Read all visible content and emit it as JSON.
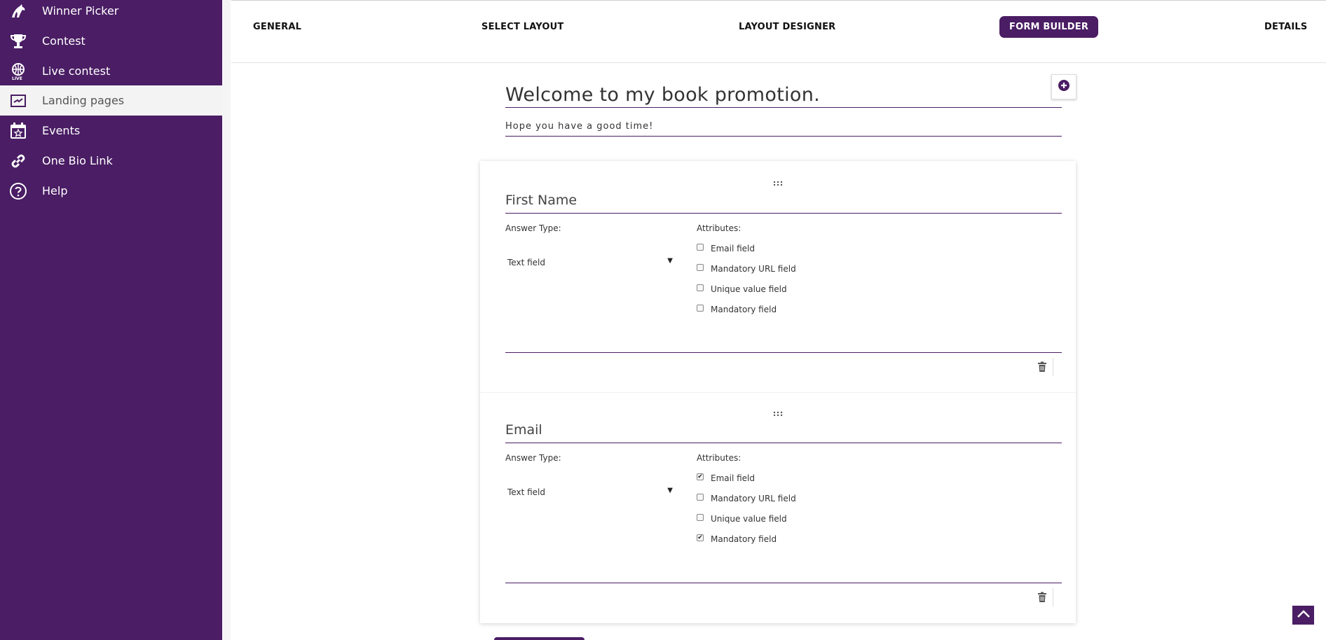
{
  "sidebar": {
    "items": [
      {
        "label": "Winner Picker",
        "icon": "winner-picker-icon"
      },
      {
        "label": "Contest",
        "icon": "trophy-icon"
      },
      {
        "label": "Live contest",
        "icon": "live-globe-icon"
      },
      {
        "label": "Landing pages",
        "icon": "landing-page-icon",
        "active": true
      },
      {
        "label": "Events",
        "icon": "calendar-star-icon"
      },
      {
        "label": "One Bio Link",
        "icon": "link-icon"
      },
      {
        "label": "Help",
        "icon": "help-circle-icon"
      }
    ]
  },
  "tabs": [
    {
      "label": "GENERAL"
    },
    {
      "label": "SELECT LAYOUT"
    },
    {
      "label": "LAYOUT DESIGNER"
    },
    {
      "label": "FORM BUILDER",
      "active": true
    },
    {
      "label": "DETAILS"
    }
  ],
  "form": {
    "title": "Welcome to my book promotion.",
    "subtitle": "Hope you have a good time!",
    "fields": [
      {
        "title": "First Name",
        "answer_type_label": "Answer Type:",
        "answer_type_value": "Text field",
        "attributes_label": "Attributes:",
        "attributes": [
          {
            "label": "Email field",
            "checked": false
          },
          {
            "label": "Mandatory URL field",
            "checked": false
          },
          {
            "label": "Unique value field",
            "checked": false
          },
          {
            "label": "Mandatory field",
            "checked": false
          }
        ]
      },
      {
        "title": "Email",
        "answer_type_label": "Answer Type:",
        "answer_type_value": "Text field",
        "attributes_label": "Attributes:",
        "attributes": [
          {
            "label": "Email field",
            "checked": true
          },
          {
            "label": "Mandatory URL field",
            "checked": false
          },
          {
            "label": "Unique value field",
            "checked": false
          },
          {
            "label": "Mandatory field",
            "checked": true
          }
        ]
      }
    ]
  },
  "colors": {
    "brand": "#4a1d64",
    "active_nav_bg": "#f3f3f3"
  }
}
